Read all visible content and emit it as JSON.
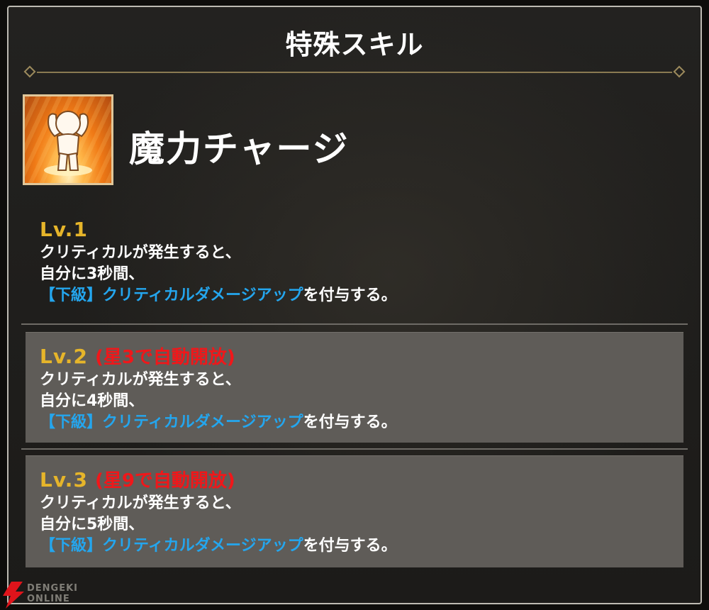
{
  "dialog": {
    "title": "特殊スキル"
  },
  "skill": {
    "icon": "arms-raised-power-icon",
    "name": "魔力チャージ"
  },
  "levels": [
    {
      "label": "Lv.1",
      "unlock": "",
      "line1": "クリティカルが発生すると、",
      "line2": "自分に3秒間、",
      "buff": "【下級】クリティカルダメージアップ",
      "suffix": "を付与する。"
    },
    {
      "label": "Lv.2",
      "unlock": "(星3で自動開放)",
      "line1": "クリティカルが発生すると、",
      "line2": "自分に4秒間、",
      "buff": "【下級】クリティカルダメージアップ",
      "suffix": "を付与する。"
    },
    {
      "label": "Lv.3",
      "unlock": "(星9で自動開放)",
      "line1": "クリティカルが発生すると、",
      "line2": "自分に5秒間、",
      "buff": "【下級】クリティカルダメージアップ",
      "suffix": "を付与する。"
    }
  ],
  "colors": {
    "level_label": "#e6b52a",
    "unlock_text": "#f0171a",
    "buff_text": "#24a6ee",
    "locked_panel": "#5f5c58"
  },
  "watermark": {
    "line1": "DENGEKI",
    "line2": "ONLINE"
  }
}
